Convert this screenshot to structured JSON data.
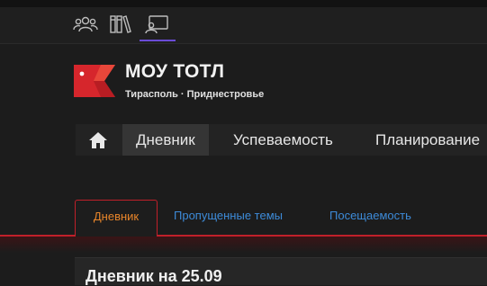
{
  "top_icons": [
    "people-icon",
    "library-icon",
    "desktop-user-icon"
  ],
  "school": {
    "name": "МОУ ТОТЛ",
    "location": "Тирасполь · Приднестровье"
  },
  "nav": {
    "items": [
      "Дневник",
      "Успеваемость",
      "Планирование"
    ]
  },
  "tabs": [
    "Дневник",
    "Пропущенные темы",
    "Посещаемость"
  ],
  "section_title": "Дневник на 25.09"
}
